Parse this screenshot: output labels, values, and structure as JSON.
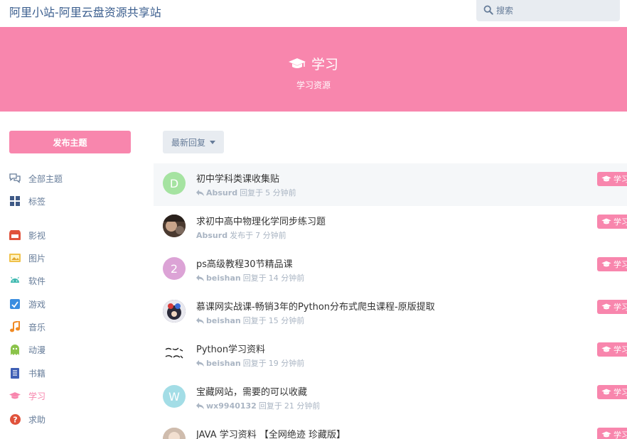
{
  "header": {
    "site_title": "阿里小站-阿里云盘资源共享站",
    "search_placeholder": "搜索"
  },
  "hero": {
    "title": "学习",
    "description": "学习资源"
  },
  "sidebar": {
    "post_button": "发布主题",
    "items": [
      {
        "label": "全部主题",
        "icon": "discussions-icon",
        "color": "#667c99"
      },
      {
        "label": "标签",
        "icon": "tags-grid-icon",
        "color": "#667c99"
      },
      {
        "label": "影视",
        "icon": "film-icon",
        "color": "#e0523b"
      },
      {
        "label": "图片",
        "icon": "image-icon",
        "color": "#f0c24a"
      },
      {
        "label": "软件",
        "icon": "android-icon",
        "color": "#3fb9b0"
      },
      {
        "label": "游戏",
        "icon": "game-icon",
        "color": "#3a8de0"
      },
      {
        "label": "音乐",
        "icon": "music-icon",
        "color": "#f08a24"
      },
      {
        "label": "动漫",
        "icon": "ghost-icon",
        "color": "#8bc34a"
      },
      {
        "label": "书籍",
        "icon": "book-icon",
        "color": "#3f5fb5"
      },
      {
        "label": "学习",
        "icon": "graduation-cap-icon",
        "color": "#f886ad"
      },
      {
        "label": "求助",
        "icon": "question-icon",
        "color": "#e0523b"
      }
    ]
  },
  "toolbar": {
    "sort_label": "最新回复"
  },
  "tag_label": "学习",
  "discussions": [
    {
      "title": "初中学科类课收集贴",
      "user": "Absurd",
      "action": "回复于",
      "time": "5 分钟前",
      "avatar_letter": "D",
      "avatar_color": "#a5e3a1",
      "replied": true
    },
    {
      "title": "求初中高中物理化学同步练习题",
      "user": "Absurd",
      "action": "发布于",
      "time": "7 分钟前",
      "avatar_letter": "",
      "avatar_color": "#5b4a3d",
      "replied": false
    },
    {
      "title": "ps高级教程30节精品课",
      "user": "beishan",
      "action": "回复于",
      "time": "14 分钟前",
      "avatar_letter": "2",
      "avatar_color": "#dca3d6",
      "replied": true
    },
    {
      "title": "慕课网实战课-畅销3年的Python分布式爬虫课程-原版提取",
      "user": "beishan",
      "action": "回复于",
      "time": "15 分钟前",
      "avatar_letter": "",
      "avatar_color": "#3b3b6b",
      "replied": true
    },
    {
      "title": "Python学习资料",
      "user": "beishan",
      "action": "回复于",
      "time": "19 分钟前",
      "avatar_letter": "",
      "avatar_color": "#ffffff",
      "replied": true
    },
    {
      "title": "宝藏网站，需要的可以收藏",
      "user": "wx9940132",
      "action": "回复于",
      "time": "21 分钟前",
      "avatar_letter": "W",
      "avatar_color": "#a3dde6",
      "replied": true
    },
    {
      "title": "JAVA 学习资料 【全网绝迹 珍藏版】",
      "user": "",
      "action": "",
      "time": "",
      "avatar_letter": "",
      "avatar_color": "#d8c6b8",
      "replied": false
    }
  ]
}
